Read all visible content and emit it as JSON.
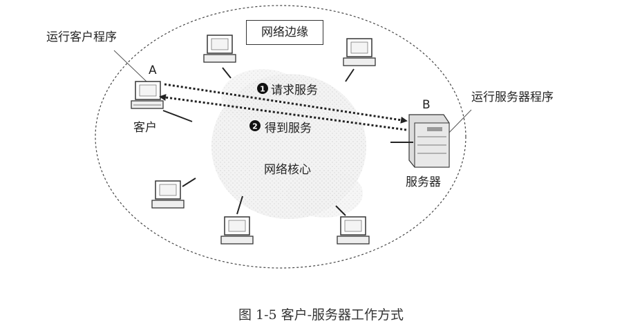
{
  "labels": {
    "network_edge": "网络边缘",
    "network_core": "网络核心",
    "client_program": "运行客户程序",
    "server_program": "运行服务器程序",
    "client_letter": "A",
    "server_letter": "B",
    "client_name": "客户",
    "server_name": "服务器"
  },
  "steps": [
    {
      "number": "1",
      "text": "请求服务"
    },
    {
      "number": "2",
      "text": "得到服务"
    }
  ],
  "caption": "图 1-5    客户-服务器工作方式"
}
